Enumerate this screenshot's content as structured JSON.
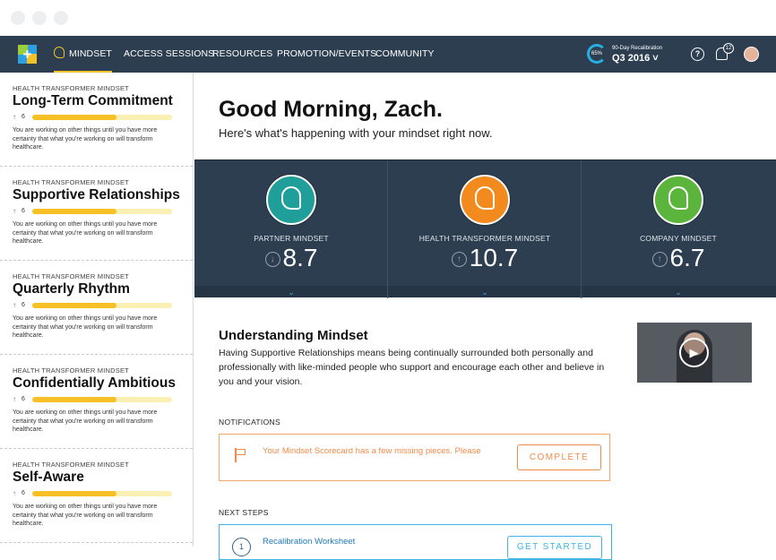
{
  "nav": {
    "items": [
      {
        "label": "MINDSET"
      },
      {
        "label": "ACCESS SESSIONS"
      },
      {
        "label": "RESOURCES"
      },
      {
        "label": "PROMOTION/EVENTS"
      },
      {
        "label": "COMMUNITY"
      }
    ],
    "progress_label": "65%",
    "progress_fraction": 0.65,
    "recalibration_label": "90-Day Recalibration",
    "recalibration_value": "Q3 2016 ˅",
    "help_glyph": "?",
    "notification_count": "12"
  },
  "sidebar": {
    "items": [
      {
        "category": "HEALTH TRANSFORMER MINDSET",
        "title": "Long-Term Commitment",
        "score": "6",
        "progress": 0.6,
        "description": "You are working on other things until you have more certainty that what you're working on will transform healthcare."
      },
      {
        "category": "HEALTH TRANSFORMER MINDSET",
        "title": "Supportive Relationships",
        "score": "6",
        "progress": 0.6,
        "description": "You are working on other things until you have more certainty that what you're working on will transform healthcare."
      },
      {
        "category": "HEALTH TRANSFORMER MINDSET",
        "title": "Quarterly Rhythm",
        "score": "6",
        "progress": 0.6,
        "description": "You are working on other things until you have more certainty that what you're working on will transform healthcare."
      },
      {
        "category": "HEALTH TRANSFORMER MINDSET",
        "title": "Confidentially Ambitious",
        "score": "6",
        "progress": 0.6,
        "description": "You are working on other things until you have more certainty that what you're working on will transform healthcare."
      },
      {
        "category": "HEALTH TRANSFORMER MINDSET",
        "title": "Self-Aware",
        "score": "6",
        "progress": 0.6,
        "description": "You are working on other things until you have more certainty that what you're working on will transform healthcare."
      }
    ]
  },
  "main": {
    "greeting": "Good Morning, Zach.",
    "subtitle": "Here's what's happening with your mindset right now.",
    "scores": [
      {
        "label": "PARTNER MINDSET",
        "value": "8.7",
        "trend": "↓",
        "color": "#1f9e9a"
      },
      {
        "label": "HEALTH TRANSFORMER MINDSET",
        "value": "10.7",
        "trend": "↑",
        "color": "#f28a1e"
      },
      {
        "label": "COMPANY MINDSET",
        "value": "6.7",
        "trend": "↑",
        "color": "#5bb53c"
      }
    ],
    "understanding": {
      "title": "Understanding Mindset",
      "text": "Having Supportive Relationships means being continually surrounded both personally and professionally with like-minded people who support and encourage each other and believe in you and your vision."
    },
    "notifications": {
      "label": "NOTIFICATIONS",
      "text": "Your Mindset Scorecard has a few missing pieces. Please",
      "button": "COMPLETE"
    },
    "next_steps": {
      "label": "NEXT STEPS",
      "step": "1",
      "title": "Recalibration Worksheet",
      "button": "GET STARTED"
    }
  },
  "colors": {
    "nav_bg": "#2c3e50",
    "accent_yellow": "#f6c026",
    "notification_orange": "#f08a4b",
    "next_steps_blue": "#3fb5e5"
  }
}
